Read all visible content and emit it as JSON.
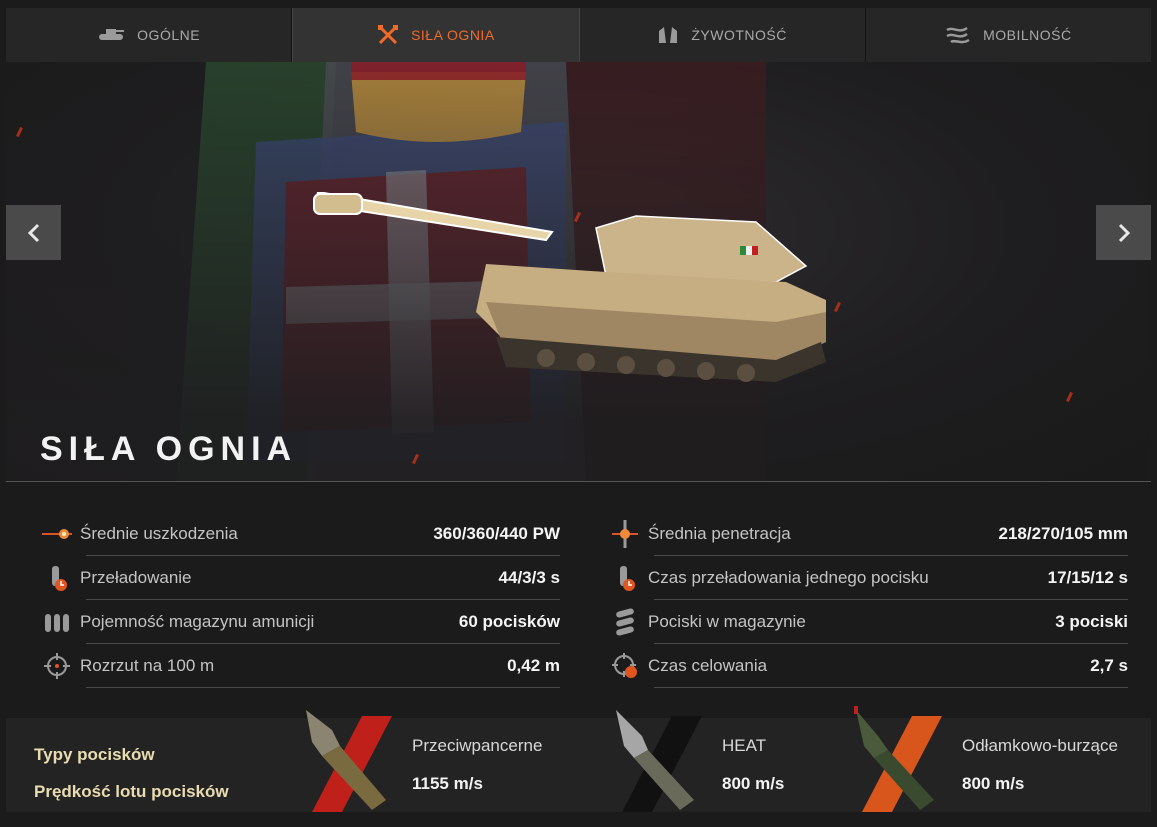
{
  "tabs": [
    {
      "label": "OGÓLNE",
      "icon": "tank-icon",
      "active": false
    },
    {
      "label": "SIŁA OGNIA",
      "icon": "crossed-guns-icon",
      "active": true
    },
    {
      "label": "ŻYWOTNOŚĆ",
      "icon": "armor-icon",
      "active": false
    },
    {
      "label": "MOBILNOŚĆ",
      "icon": "wind-icon",
      "active": false
    }
  ],
  "hero": {
    "title": "SIŁA OGNIA",
    "prev_icon": "chevron-left-icon",
    "next_icon": "chevron-right-icon"
  },
  "stats": {
    "left": [
      {
        "label": "Średnie uszkodzenia",
        "value": "360/360/440 PW",
        "icon": "damage-icon"
      },
      {
        "label": "Przeładowanie",
        "value": "44/3/3 s",
        "icon": "reload-icon"
      },
      {
        "label": "Pojemność magazynu amunicji",
        "value": "60 pocisków",
        "icon": "ammo-icon"
      },
      {
        "label": "Rozrzut na 100 m",
        "value": "0,42 m",
        "icon": "dispersion-icon"
      }
    ],
    "right": [
      {
        "label": "Średnia penetracja",
        "value": "218/270/105 mm",
        "icon": "penetration-icon"
      },
      {
        "label": "Czas przeładowania jednego pocisku",
        "value": "17/15/12 s",
        "icon": "shell-reload-icon"
      },
      {
        "label": "Pociski w magazynie",
        "value": "3 pociski",
        "icon": "magazine-icon"
      },
      {
        "label": "Czas celowania",
        "value": "2,7 s",
        "icon": "aim-time-icon"
      }
    ]
  },
  "shells": {
    "type_label": "Typy pocisków",
    "speed_label": "Prędkość lotu pocisków",
    "items": [
      {
        "name": "Przeciwpancerne",
        "speed": "1155 m/s",
        "color": "#c0201a"
      },
      {
        "name": "HEAT",
        "speed": "800 m/s",
        "color": "#111111"
      },
      {
        "name": "Odłamkowo-burzące",
        "speed": "800 m/s",
        "color": "#d8561c"
      }
    ]
  },
  "colors": {
    "accent": "#f06a2a",
    "title": "#f2f2f2",
    "shell_label": "#e9dcb0"
  }
}
